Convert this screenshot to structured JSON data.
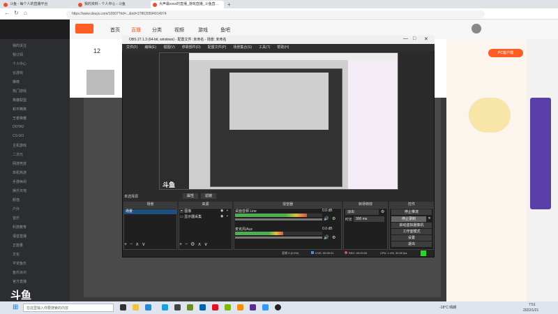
{
  "browser": {
    "tabs": [
      {
        "label": "斗鱼 - 每个人的直播平台"
      },
      {
        "label": "我的资料 - 个人中心 - 斗鱼"
      },
      {
        "label": "大声最xxxx的直播_游戏直播_斗鱼直…"
      }
    ],
    "url": "https://www.douyu.com/10507?rid=...&rid=278630594914974"
  },
  "douyu": {
    "nav": [
      "首页",
      "直播",
      "分类",
      "视频",
      "游戏",
      "鱼吧"
    ],
    "room_number": "12",
    "notice": "PC客户端"
  },
  "sidebar": {
    "items": [
      "我的关注",
      "我订阅",
      "个人中心",
      "云游戏",
      "推荐",
      "热门游戏",
      "英雄联盟",
      "和平精英",
      "王者荣耀",
      "DOTA2",
      "CS:GO",
      "主机游戏",
      "二次元",
      "网游竞技",
      "单机热游",
      "手游休闲",
      "娱乐天地",
      "颜值",
      "户外",
      "音乐",
      "科技教育",
      "语音直播",
      "正能量",
      "文化",
      "平安鱼乐",
      "鱼乐派对",
      "官方直播"
    ]
  },
  "obs": {
    "title": "OBS 27.1.3 (64-bit, windows) - 配置文件: 未命名 - 场景: 未命名",
    "menu": [
      "文件(F)",
      "编辑(E)",
      "视图(V)",
      "停靠部件(D)",
      "配置文件(P)",
      "场景集合(S)",
      "工具(T)",
      "帮助(H)"
    ],
    "preview_logo": "斗鱼",
    "unselected": "未选择源",
    "prop_btn": "属性",
    "filter_btn": "滤镜",
    "docks": {
      "scenes": "场景",
      "sources": "来源",
      "mixer": "混音器",
      "transitions": "转场特效",
      "controls": "控件"
    },
    "scene_item": "场景",
    "sources_list": [
      "图像",
      "显示器采集"
    ],
    "mixer_channels": [
      {
        "name": "桌面音频 Line",
        "db": "0.0 dB",
        "level": 0.82
      },
      {
        "name": "麦克风/Aux",
        "db": "0.0 dB",
        "level": 0.55
      }
    ],
    "transition": {
      "type": "淡出",
      "duration_label": "时长",
      "duration": "300 ms"
    },
    "controls": [
      "停止推流",
      "停止录制",
      "启动虚拟摄像机",
      "工作室模式",
      "设置",
      "退出"
    ],
    "status": {
      "dropped": "丢帧 0 (0.0%)",
      "live": "LIVE: 00:00:01",
      "rec": "REC: 00:00:00",
      "cpu": "CPU: 1.4%, 30.00 fps"
    }
  },
  "taskbar": {
    "search_placeholder": "在这里输入你要搜索的内容",
    "weather": "-18°C 晴朗",
    "time": "7:51",
    "date": "2022/1/21"
  },
  "colors": {
    "douyu_orange": "#ff5d23",
    "obs_bg": "#2b2b2b",
    "meter_green": "#4caf50"
  }
}
